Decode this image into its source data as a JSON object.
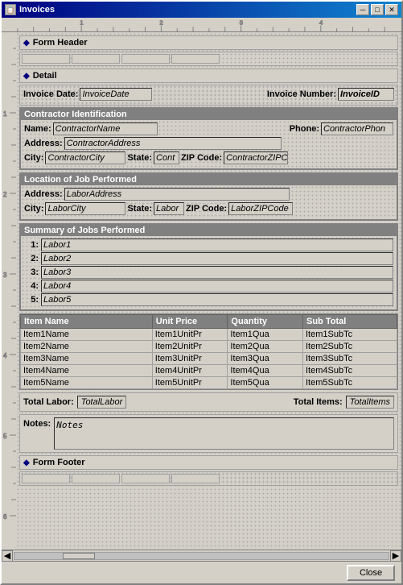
{
  "window": {
    "title": "Invoices",
    "title_icon": "📋",
    "minimize_btn": "─",
    "maximize_btn": "□",
    "close_btn": "✕"
  },
  "form_header": {
    "label": "Form Header"
  },
  "detail": {
    "label": "Detail"
  },
  "form_footer": {
    "label": "Form Footer"
  },
  "invoice": {
    "date_label": "Invoice Date:",
    "date_value": "InvoiceDate",
    "number_label": "Invoice Number:",
    "number_value": "InvoiceID"
  },
  "contractor": {
    "section_title": "Contractor Identification",
    "name_label": "Name:",
    "name_value": "ContractorName",
    "phone_label": "Phone:",
    "phone_value": "ContractorPhon",
    "address_label": "Address:",
    "address_value": "ContractorAddress",
    "city_label": "City:",
    "city_value": "ContractorCity",
    "state_label": "State:",
    "state_value": "Cont",
    "zip_label": "ZIP Code:",
    "zip_value": "ContractorZIPC"
  },
  "location": {
    "section_title": "Location of Job Performed",
    "address_label": "Address:",
    "address_value": "LaborAddress",
    "city_label": "City:",
    "city_value": "LaborCity",
    "state_label": "State:",
    "state_value": "Labor",
    "zip_label": "ZIP Code:",
    "zip_value": "LaborZIPCode"
  },
  "summary": {
    "section_title": "Summary of Jobs Performed",
    "items": [
      {
        "num": "1:",
        "value": "Labor1"
      },
      {
        "num": "2:",
        "value": "Labor2"
      },
      {
        "num": "3:",
        "value": "Labor3"
      },
      {
        "num": "4:",
        "value": "Labor4"
      },
      {
        "num": "5:",
        "value": "Labor5"
      }
    ]
  },
  "items_table": {
    "headers": [
      "Item Name",
      "Unit Price",
      "Quantity",
      "Sub Total"
    ],
    "rows": [
      {
        "name": "Item1Name",
        "unit_price": "Item1UnitPr",
        "quantity": "Item1Qua",
        "subtotal": "Item1SubTc"
      },
      {
        "name": "Item2Name",
        "unit_price": "Item2UnitPr",
        "quantity": "Item2Qua",
        "subtotal": "Item2SubTc"
      },
      {
        "name": "Item3Name",
        "unit_price": "Item3UnitPr",
        "quantity": "Item3Qua",
        "subtotal": "Item3SubTc"
      },
      {
        "name": "Item4Name",
        "unit_price": "Item4UnitPr",
        "quantity": "Item4Qua",
        "subtotal": "Item4SubTc"
      },
      {
        "name": "Item5Name",
        "unit_price": "Item5UnitPr",
        "quantity": "Item5Qua",
        "subtotal": "Item5SubTc"
      }
    ]
  },
  "totals": {
    "labor_label": "Total Labor:",
    "labor_value": "TotalLabor",
    "items_label": "Total Items:",
    "items_value": "TotalItems"
  },
  "notes": {
    "label": "Notes:",
    "value": "Notes"
  },
  "toolbar": {
    "close_label": "Close"
  }
}
